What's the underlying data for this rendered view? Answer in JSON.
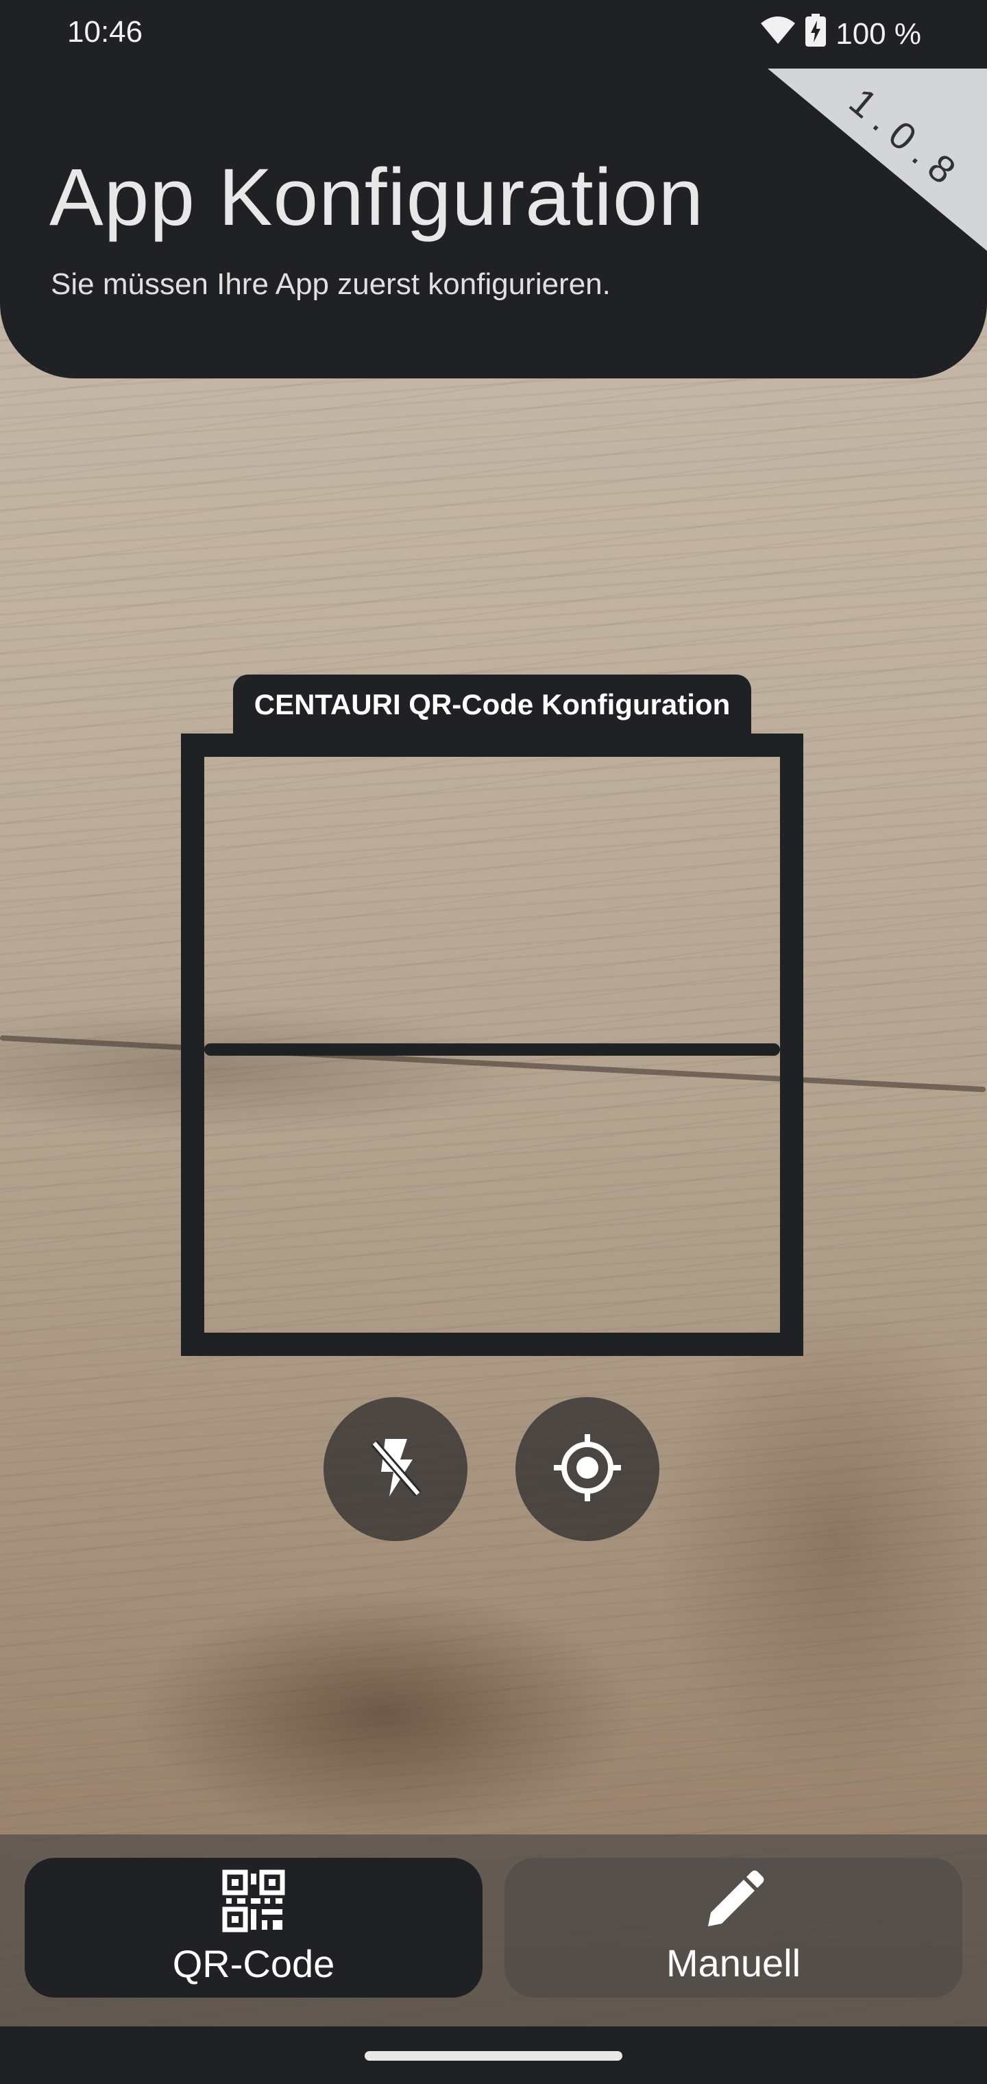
{
  "status_bar": {
    "time": "10:46",
    "battery": "100 %",
    "wifi_icon": "wifi-icon",
    "battery_icon": "battery-charging-icon"
  },
  "header": {
    "title": "App Konfiguration",
    "subtitle": "Sie müssen Ihre App zuerst konfigurieren.",
    "version": "1.0.8"
  },
  "scanner": {
    "label": "CENTAURI QR-Code Konfiguration"
  },
  "controls": {
    "flash_icon": "flash-off-icon",
    "focus_icon": "focus-target-icon"
  },
  "bottom_nav": {
    "items": [
      {
        "label": "QR-Code",
        "icon": "qr-code-icon",
        "selected": true
      },
      {
        "label": "Manuell",
        "icon": "pencil-icon",
        "selected": false
      }
    ]
  },
  "colors": {
    "dark": "#202124",
    "ribbon": "#d4d5d7",
    "text_light": "#e8e8e8"
  }
}
